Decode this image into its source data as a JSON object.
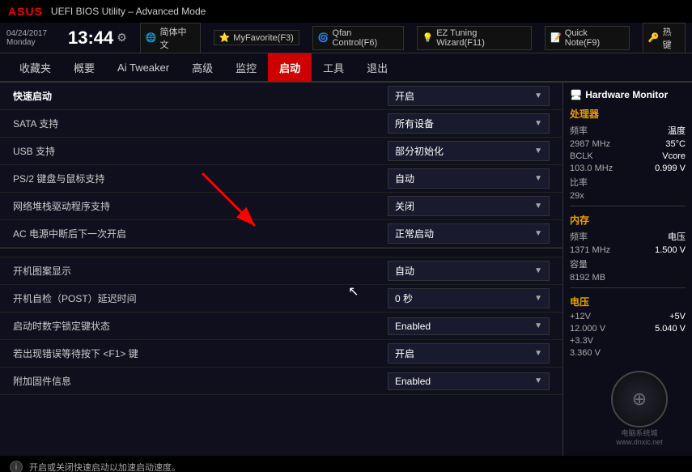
{
  "titleBar": {
    "logo": "ASUS",
    "title": "UEFI BIOS Utility – Advanced Mode"
  },
  "topBar": {
    "date": "04/24/2017",
    "day": "Monday",
    "time": "13:44",
    "gearIcon": "⚙",
    "buttons": [
      {
        "icon": "🌐",
        "label": "简体中文"
      },
      {
        "icon": "⭐",
        "label": "MyFavorite(F3)"
      },
      {
        "icon": "🌀",
        "label": "Qfan Control(F6)"
      },
      {
        "icon": "💡",
        "label": "EZ Tuning Wizard(F11)"
      },
      {
        "icon": "📝",
        "label": "Quick Note(F9)"
      },
      {
        "icon": "🔑",
        "label": "热键"
      }
    ]
  },
  "nav": {
    "items": [
      {
        "label": "收藏夹",
        "active": false
      },
      {
        "label": "概要",
        "active": false
      },
      {
        "label": "Ai Tweaker",
        "active": false
      },
      {
        "label": "高级",
        "active": false
      },
      {
        "label": "监控",
        "active": false
      },
      {
        "label": "启动",
        "active": true
      },
      {
        "label": "工具",
        "active": false
      },
      {
        "label": "退出",
        "active": false
      }
    ]
  },
  "settings": [
    {
      "label": "快速启动",
      "value": "开启",
      "bold": true,
      "divider": false
    },
    {
      "label": "SATA 支持",
      "value": "所有设备",
      "bold": false,
      "divider": false
    },
    {
      "label": "USB 支持",
      "value": "部分初始化",
      "bold": false,
      "divider": false
    },
    {
      "label": "PS/2 键盘与鼠标支持",
      "value": "自动",
      "bold": false,
      "divider": false
    },
    {
      "label": "网络堆栈驱动程序支持",
      "value": "关闭",
      "bold": false,
      "divider": false
    },
    {
      "label": "AC 电源中断后下一次开启",
      "value": "正常启动",
      "bold": false,
      "divider": false
    },
    {
      "label": "",
      "value": "",
      "bold": false,
      "divider": true
    },
    {
      "label": "开机图案显示",
      "value": "自动",
      "bold": false,
      "divider": false
    },
    {
      "label": "开机自检（POST）延迟时间",
      "value": "0 秒",
      "bold": false,
      "divider": false
    },
    {
      "label": "启动时数字锁定键状态",
      "value": "Enabled",
      "bold": false,
      "divider": false
    },
    {
      "label": "若出现错误等待按下 <F1> 键",
      "value": "开启",
      "bold": false,
      "divider": false
    },
    {
      "label": "附加固件信息",
      "value": "Enabled",
      "bold": false,
      "divider": false
    }
  ],
  "statusBar": {
    "icon": "i",
    "text": "开启或关闭快速启动以加速启动速度。"
  },
  "sidebar": {
    "title": "Hardware Monitor",
    "titleIcon": "🖥",
    "sections": [
      {
        "name": "处理器",
        "rows": [
          {
            "key": "频率",
            "value": "温度"
          },
          {
            "key": "2987 MHz",
            "value": "35°C"
          },
          {
            "key": "BCLK",
            "value": "Vcore"
          },
          {
            "key": "103.0 MHz",
            "value": "0.999 V"
          },
          {
            "key": "比率",
            "value": ""
          },
          {
            "key": "29x",
            "value": ""
          }
        ]
      },
      {
        "name": "内存",
        "rows": [
          {
            "key": "频率",
            "value": "电压"
          },
          {
            "key": "1371 MHz",
            "value": "1.500 V"
          },
          {
            "key": "容量",
            "value": ""
          },
          {
            "key": "8192 MB",
            "value": ""
          }
        ]
      },
      {
        "name": "电压",
        "rows": [
          {
            "key": "+12V",
            "value": "+5V"
          },
          {
            "key": "12.000 V",
            "value": "5.040 V"
          },
          {
            "key": "+3.3V",
            "value": ""
          },
          {
            "key": "3.360 V",
            "value": ""
          }
        ]
      }
    ]
  }
}
